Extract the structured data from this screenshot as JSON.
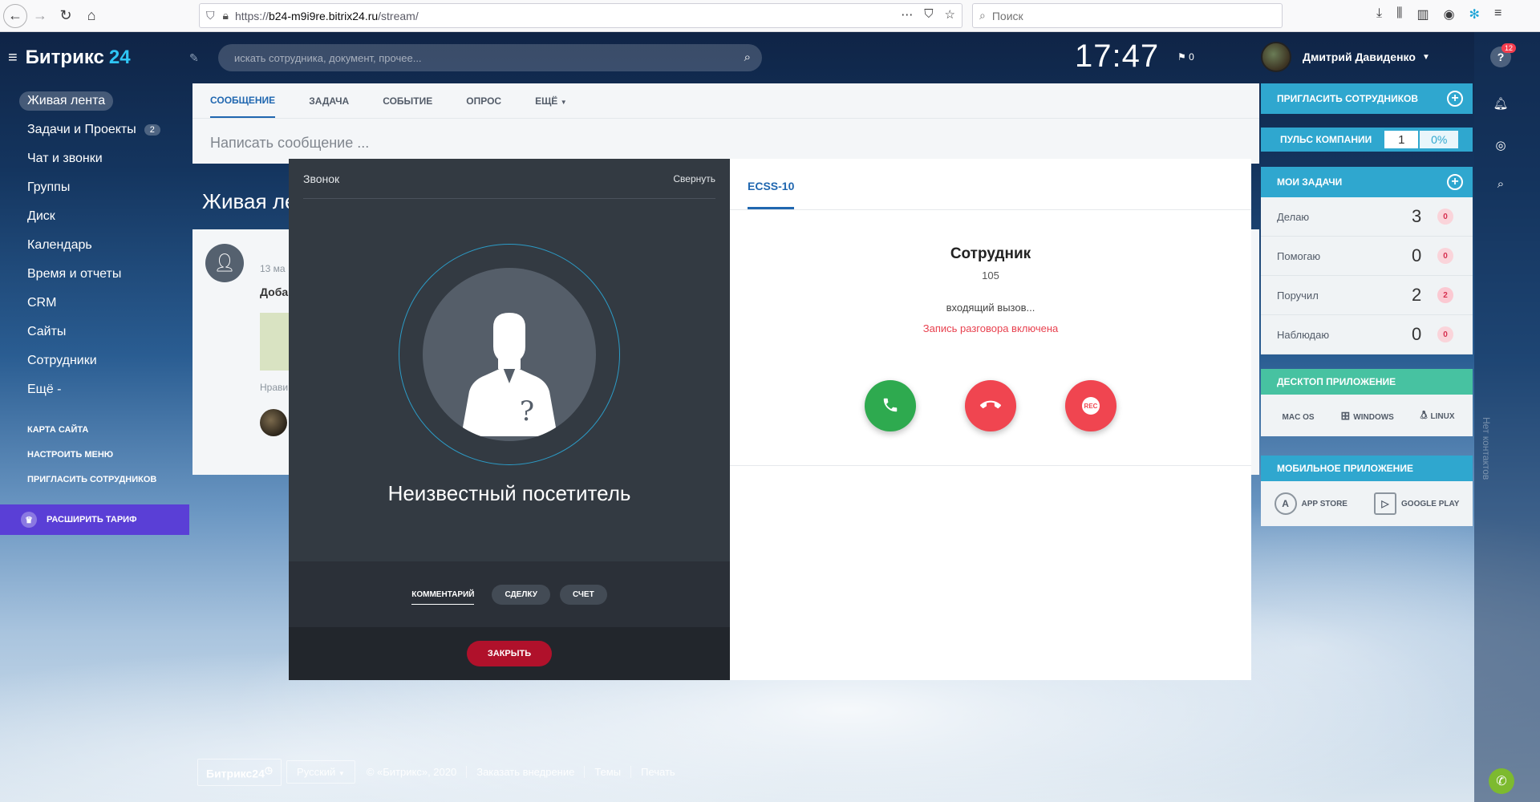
{
  "browser": {
    "url_prefix": "https://",
    "url_domain": "b24-m9i9re.bitrix24.ru",
    "url_path": "/stream/",
    "more_icon": "⋯",
    "search_placeholder": "Поиск"
  },
  "header": {
    "logo_text": "Битрикс",
    "logo_num": "24",
    "search_placeholder": "искать сотрудника, документ, прочее...",
    "clock": "17:47",
    "flag_count": "0",
    "user_name": "Дмитрий Давиденко",
    "notifications_badge": "12"
  },
  "menu": {
    "items": [
      {
        "label": "Живая лента",
        "active": true
      },
      {
        "label": "Задачи и Проекты",
        "count": "2"
      },
      {
        "label": "Чат и звонки"
      },
      {
        "label": "Группы"
      },
      {
        "label": "Диск"
      },
      {
        "label": "Календарь"
      },
      {
        "label": "Время и отчеты"
      },
      {
        "label": "CRM"
      },
      {
        "label": "Сайты"
      },
      {
        "label": "Сотрудники"
      },
      {
        "label": "Ещё -"
      }
    ],
    "small": [
      "КАРТА САЙТА",
      "НАСТРОИТЬ МЕНЮ",
      "ПРИГЛАСИТЬ СОТРУДНИКОВ"
    ],
    "tariff": "РАСШИРИТЬ ТАРИФ"
  },
  "composer": {
    "tabs": [
      "СООБЩЕНИЕ",
      "ЗАДАЧА",
      "СОБЫТИЕ",
      "ОПРОС",
      "ЕЩЁ"
    ],
    "placeholder": "Написать сообщение ..."
  },
  "feed": {
    "title": "Живая ле",
    "post_date": "13 ма",
    "post_title": "Доба",
    "like_text": "Нрави"
  },
  "call": {
    "header_title": "Звонок",
    "minimize": "Свернуть",
    "caller_name": "Неизвестный посетитель",
    "actions": [
      "КОММЕНТАРИЙ",
      "СДЕЛКУ",
      "СЧЕТ"
    ],
    "close": "ЗАКРЫТЬ",
    "tab": "ECSS-10",
    "employee": "Сотрудник",
    "extension": "105",
    "status": "входящий вызов...",
    "recording": "Запись разговора включена",
    "rec_label": "REC"
  },
  "right_panel": {
    "invite": "ПРИГЛАСИТЬ СОТРУДНИКОВ",
    "pulse_label": "ПУЛЬС КОМПАНИИ",
    "pulse_value": "1",
    "pulse_percent": "0%",
    "tasks_title": "МОИ ЗАДАЧИ",
    "tasks": [
      {
        "label": "Делаю",
        "count": "3",
        "badge": "0"
      },
      {
        "label": "Помогаю",
        "count": "0",
        "badge": "0"
      },
      {
        "label": "Поручил",
        "count": "2",
        "badge": "2"
      },
      {
        "label": "Наблюдаю",
        "count": "0",
        "badge": "0"
      }
    ],
    "desktop_title": "ДЕСКТОП ПРИЛОЖЕНИЕ",
    "desktop_apps": [
      "MAC OS",
      "WINDOWS",
      "LINUX"
    ],
    "mobile_title": "МОБИЛЬНОЕ ПРИЛОЖЕНИЕ",
    "mobile_apps": [
      "APP STORE",
      "GOOGLE PLAY"
    ],
    "no_contacts": "Нет контактов"
  },
  "footer": {
    "brand": "Битрикс24",
    "language": "Русский",
    "copyright": "© «Битрикс», 2020",
    "links": [
      "Заказать внедрение",
      "Темы",
      "Печать"
    ]
  },
  "colors": {
    "accent": "#2067b0",
    "panel_blue": "#2fa7cf",
    "answer_green": "#2eaa4f",
    "hangup_red": "#f04550",
    "close_red": "#b0112b",
    "tariff_purple": "#5a3fd6"
  }
}
